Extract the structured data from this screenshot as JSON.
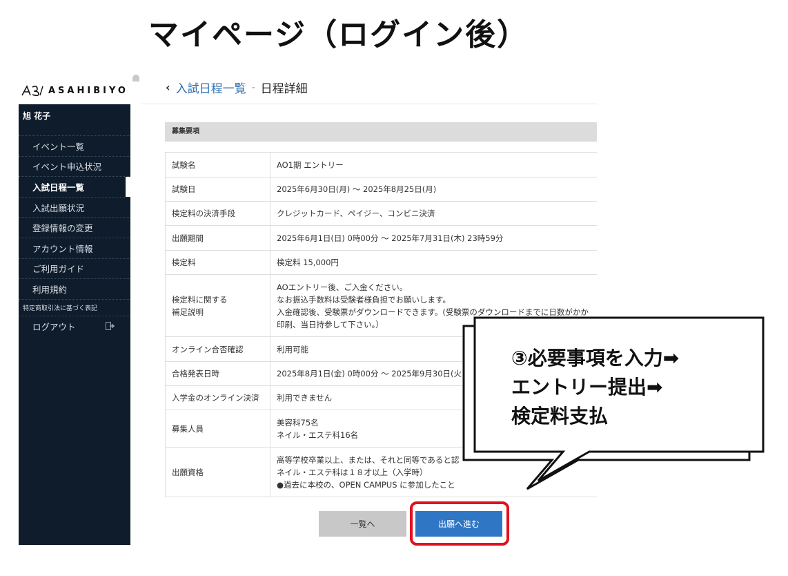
{
  "slide": {
    "title": "マイページ（ログイン後）"
  },
  "brand": {
    "logo_text": "ASAHIBIYO"
  },
  "sidebar": {
    "user_name": "旭 花子",
    "items": [
      {
        "label": "イベント一覧"
      },
      {
        "label": "イベント申込状況"
      },
      {
        "label": "入試日程一覧"
      },
      {
        "label": "入試出願状況"
      },
      {
        "label": "登録情報の変更"
      },
      {
        "label": "アカウント情報"
      },
      {
        "label": "ご利用ガイド"
      },
      {
        "label": "利用規約"
      },
      {
        "label": "特定商取引法に基づく表記"
      },
      {
        "label": "ログアウト"
      }
    ],
    "active_item": "入試日程一覧"
  },
  "breadcrumb": {
    "back_icon": "chevron-left-icon",
    "link": "入試日程一覧",
    "separator": "-",
    "current": "日程詳細"
  },
  "section": {
    "title": "募集要項"
  },
  "details": {
    "rows": [
      {
        "label": "試験名",
        "value": [
          "AO1期 エントリー"
        ]
      },
      {
        "label": "試験日",
        "value": [
          "2025年6月30日(月) ～ 2025年8月25日(月)"
        ]
      },
      {
        "label": "検定料の決済手段",
        "value": [
          "クレジットカード、ペイジー、コンビニ決済"
        ]
      },
      {
        "label": "出願期間",
        "value": [
          "2025年6月1日(日) 0時00分 ～ 2025年7月31日(木) 23時59分"
        ]
      },
      {
        "label": "検定料",
        "value": [
          "検定料 15,000円"
        ]
      },
      {
        "label": "検定料に関する補足説明",
        "label_lines": [
          "検定料に関する",
          "補足説明"
        ],
        "value": [
          "AOエントリー後、ご入金ください。",
          "なお振込手数料は受験者様負担でお願いします。",
          "入金確認後、受験票がダウンロードできます。(受験票のダウンロードまでに日数がかか",
          "印刷、当日持参して下さい。）"
        ]
      },
      {
        "label": "オンライン合否確認",
        "value": [
          "利用可能"
        ]
      },
      {
        "label": "合格発表日時",
        "value": [
          "2025年8月1日(金) 0時00分 ～ 2025年9月30日(火"
        ]
      },
      {
        "label": "入学金のオンライン決済",
        "value": [
          "利用できません"
        ]
      },
      {
        "label": "募集人員",
        "value": [
          "美容科75名",
          "ネイル・エステ科16名"
        ]
      },
      {
        "label": "出願資格",
        "value": [
          "高等学校卒業以上、または、それと同等であると認",
          "ネイル・エステ科は１８才以上（入学時）",
          "●過去に本校の、OPEN CAMPUS に参加したこと"
        ]
      }
    ]
  },
  "buttons": {
    "back_to_list": "一覧へ",
    "proceed": "出願へ進む"
  },
  "callout": {
    "lines": [
      "③必要事項を入力➡",
      "エントリー提出➡",
      "検定料支払"
    ]
  },
  "colors": {
    "sidebar_bg": "#0e1c2c",
    "link": "#2b6cb0",
    "primary_button": "#2f76c4",
    "highlight": "#e2101e"
  }
}
